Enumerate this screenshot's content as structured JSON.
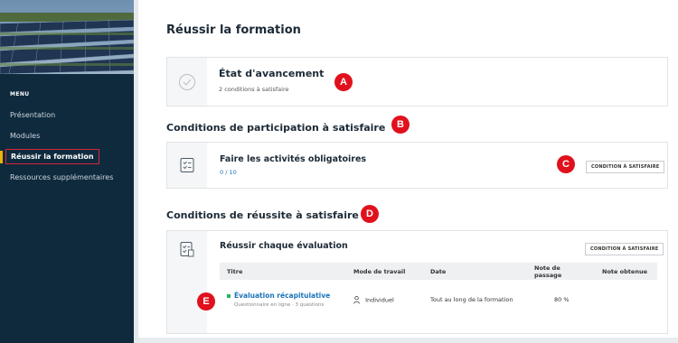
{
  "sidebar": {
    "menu_label": "MENU",
    "items": [
      {
        "label": "Présentation",
        "active": false
      },
      {
        "label": "Modules",
        "active": false
      },
      {
        "label": "Réussir la formation",
        "active": true
      },
      {
        "label": "Ressources supplémentaires",
        "active": false
      }
    ]
  },
  "page": {
    "title": "Réussir la formation"
  },
  "progress": {
    "title": "État d'avancement",
    "subtitle": "2 conditions à satisfaire",
    "icon": "check-circle-icon"
  },
  "participation": {
    "section_title": "Conditions de participation à satisfaire",
    "card_title": "Faire les activités obligatoires",
    "progress_text": "0 / 10",
    "badge": "CONDITION À SATISFAIRE",
    "icon": "checklist-icon"
  },
  "success": {
    "section_title": "Conditions de réussite à satisfaire",
    "card_title": "Réussir chaque évaluation",
    "badge": "CONDITION À SATISFAIRE",
    "icon": "checklist-doc-icon",
    "table": {
      "headers": [
        "Titre",
        "Mode de travail",
        "Date",
        "Note de passage",
        "Note obtenue"
      ],
      "rows": [
        {
          "title": "Évaluation récapitulative",
          "subtitle": "Questionnaire en ligne · 3 questions",
          "mode": "Individuel",
          "date": "Tout au long de la formation",
          "pass_grade": "80 %",
          "grade": ""
        }
      ]
    }
  },
  "markers": [
    "A",
    "B",
    "C",
    "D",
    "E"
  ],
  "colors": {
    "sidebar_bg": "#0f2a3d",
    "accent_blue": "#1a73b8",
    "marker_red": "#e0111d",
    "active_border": "#d7263d",
    "status_green": "#29b36a"
  }
}
